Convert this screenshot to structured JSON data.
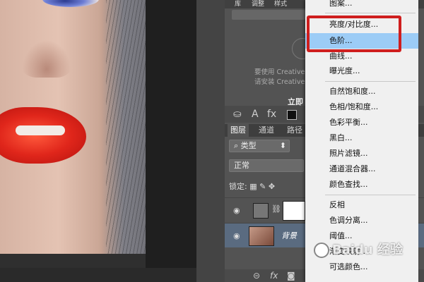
{
  "library": {
    "tabs": [
      "库",
      "调整",
      "样式"
    ],
    "cc_message_line1": "要使用 Creative",
    "cc_message_line2": "请安装 Creative",
    "link_text": "立即"
  },
  "char_tools": [
    "A",
    "fx"
  ],
  "layers_panel": {
    "tabs": [
      "图层",
      "通道",
      "路径"
    ],
    "filter_label": "类型",
    "blend_mode": "正常",
    "lock_label": "锁定:",
    "layers": [
      {
        "name": "",
        "type": "adjustment"
      },
      {
        "name": "背景",
        "type": "image"
      }
    ],
    "footer_icons": [
      "link-icon",
      "fx-icon",
      "mask-icon"
    ]
  },
  "menu": {
    "items": [
      {
        "label": "图案...",
        "highlighted": false
      },
      {
        "label": "亮度/对比度...",
        "highlighted": false
      },
      {
        "label": "色阶...",
        "highlighted": true
      },
      {
        "label": "曲线...",
        "highlighted": false
      },
      {
        "label": "曝光度...",
        "highlighted": false
      },
      {
        "label": "自然饱和度...",
        "highlighted": false
      },
      {
        "label": "色相/饱和度...",
        "highlighted": false
      },
      {
        "label": "色彩平衡...",
        "highlighted": false
      },
      {
        "label": "黑白...",
        "highlighted": false
      },
      {
        "label": "照片滤镜...",
        "highlighted": false
      },
      {
        "label": "通道混合器...",
        "highlighted": false
      },
      {
        "label": "颜色查找...",
        "highlighted": false
      },
      {
        "label": "反相",
        "highlighted": false
      },
      {
        "label": "色调分离...",
        "highlighted": false
      },
      {
        "label": "阈值...",
        "highlighted": false
      },
      {
        "label": "渐变映射...",
        "highlighted": false
      },
      {
        "label": "可选颜色...",
        "highlighted": false
      }
    ]
  },
  "watermark": "Baidu 经验",
  "colors": {
    "highlight": "#9cccf6",
    "annotation": "#cf1e1e",
    "panel": "#535353"
  }
}
